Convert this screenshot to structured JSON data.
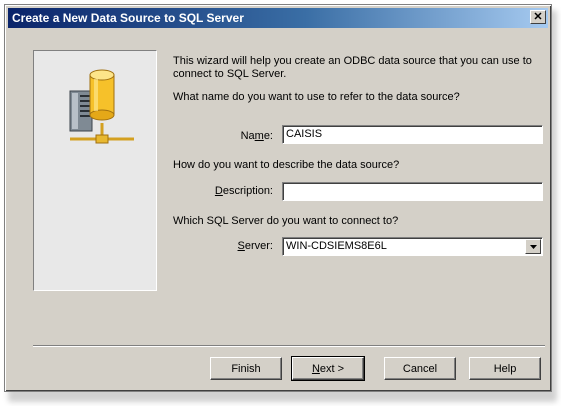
{
  "window": {
    "title": "Create a New Data Source to SQL Server",
    "close_glyph": "✕"
  },
  "wizard": {
    "intro": "This wizard will help you create an ODBC data source that you can use to connect to SQL Server.",
    "name_question": "What name do you want to use to refer to the data source?",
    "name_label_pre": "Na",
    "name_label_accel": "m",
    "name_label_post": "e:",
    "name_value": "CAISIS",
    "desc_question": "How do you want to describe the data source?",
    "desc_label_pre": "",
    "desc_label_accel": "D",
    "desc_label_post": "escription:",
    "desc_value": "",
    "server_question": "Which SQL Server do you want to connect to?",
    "server_label_pre": "",
    "server_label_accel": "S",
    "server_label_post": "erver:",
    "server_value": "WIN-CDSIEMS8E6L"
  },
  "buttons": {
    "finish": "Finish",
    "next_accel": "N",
    "next_rest": "ext >",
    "cancel": "Cancel",
    "help": "Help"
  },
  "icons": {
    "server": "server-database-icon",
    "dropdown": "chevron-down-icon"
  },
  "colors": {
    "dialog_bg": "#d4d0c8",
    "title_start": "#0a246a",
    "title_end": "#a6caf0",
    "db_cylinder": "#f6c12a"
  }
}
